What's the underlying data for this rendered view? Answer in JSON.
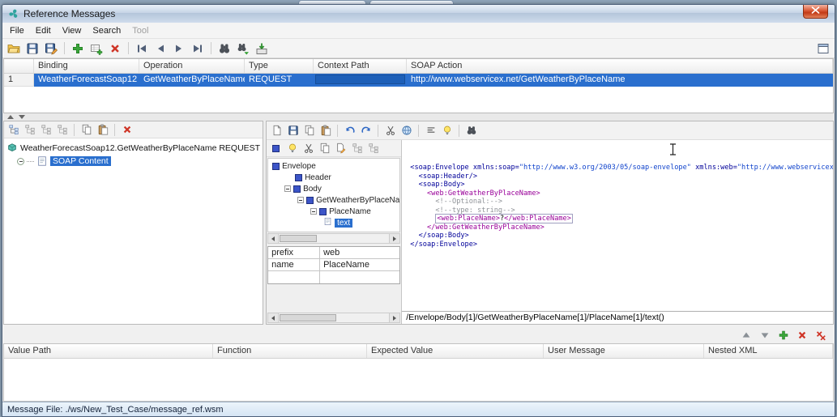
{
  "colors": {
    "selection": "#2a6fce",
    "close_button": "#c23a16",
    "context_path_field": "#1d5fb8"
  },
  "window": {
    "title": "Reference Messages"
  },
  "menu": {
    "items": [
      "File",
      "Edit",
      "View",
      "Search",
      "Tool"
    ],
    "disabled": [
      "Tool"
    ]
  },
  "main_toolbar": {
    "icons": [
      "open",
      "save",
      "save-as",
      "add",
      "add-row",
      "delete",
      "first-record",
      "previous-record",
      "next-record",
      "last-record",
      "find",
      "find-next",
      "import",
      "panel-toggle"
    ]
  },
  "bindings_table": {
    "columns": {
      "binding": "Binding",
      "operation": "Operation",
      "type": "Type",
      "context_path": "Context Path",
      "soap_action": "SOAP Action"
    },
    "row": {
      "num": "1",
      "binding": "WeatherForecastSoap12",
      "operation": "GetWeatherByPlaceName",
      "type": "REQUEST",
      "context_path": "",
      "soap_action": "http://www.webservicex.net/GetWeatherByPlaceName"
    }
  },
  "message_tree": {
    "root": "WeatherForecastSoap12.GetWeatherByPlaceName REQUEST",
    "soap_content": "SOAP Content"
  },
  "xml_tree": {
    "envelope": "Envelope",
    "header": "Header",
    "body": "Body",
    "operation": "GetWeatherByPlaceNa",
    "placename": "PlaceName",
    "text": "text"
  },
  "properties": {
    "rows": [
      [
        "prefix",
        "web"
      ],
      [
        "name",
        "PlaceName"
      ],
      [
        "",
        ""
      ]
    ]
  },
  "xml_editor": {
    "colors": {
      "tag": "#000099",
      "webtag": "#990099",
      "string": "#1144cc",
      "comment": "#8f9398",
      "text": "#000000"
    },
    "lines": [
      {
        "pre": "",
        "t": [
          [
            "t",
            "<soap:Envelope "
          ],
          [
            "t",
            "xmlns:soap="
          ],
          [
            "s",
            "\"http://www.w3.org/2003/05/soap-envelope\""
          ],
          [
            "t",
            " xmlns:web="
          ],
          [
            "s",
            "\"http://www.webservicex.net\""
          ],
          [
            "t",
            ">"
          ]
        ]
      },
      {
        "pre": "  ",
        "t": [
          [
            "t",
            "<soap:Header/>"
          ]
        ]
      },
      {
        "pre": "  ",
        "t": [
          [
            "t",
            "<soap:Body>"
          ]
        ]
      },
      {
        "pre": "    ",
        "t": [
          [
            "w",
            "<web:GetWeatherByPlaceName>"
          ]
        ]
      },
      {
        "pre": "      ",
        "t": [
          [
            "c",
            "<!--Optional:-->"
          ]
        ]
      },
      {
        "pre": "      ",
        "t": [
          [
            "c",
            "<!--type: string-->"
          ]
        ]
      },
      {
        "pre": "      ",
        "box": true,
        "t": [
          [
            "w",
            "<web:PlaceName>"
          ],
          [
            "x",
            "?"
          ],
          [
            "w",
            "</web:PlaceName>"
          ]
        ]
      },
      {
        "pre": "    ",
        "t": [
          [
            "w",
            "</web:GetWeatherByPlaceName>"
          ]
        ]
      },
      {
        "pre": "  ",
        "t": [
          [
            "t",
            "</soap:Body>"
          ]
        ]
      },
      {
        "pre": "",
        "t": [
          [
            "t",
            "</soap:Envelope>"
          ]
        ]
      }
    ]
  },
  "xpath_bar": {
    "value": "/Envelope/Body[1]/GetWeatherByPlaceName[1]/PlaceName[1]/text()"
  },
  "assertions_table": {
    "columns": {
      "value_path": "Value Path",
      "function": "Function",
      "expected_value": "Expected Value",
      "user_message": "User Message",
      "nested_xml": "Nested XML"
    }
  },
  "status_bar": {
    "text": "Message File: ./ws/New_Test_Case/message_ref.wsm"
  }
}
